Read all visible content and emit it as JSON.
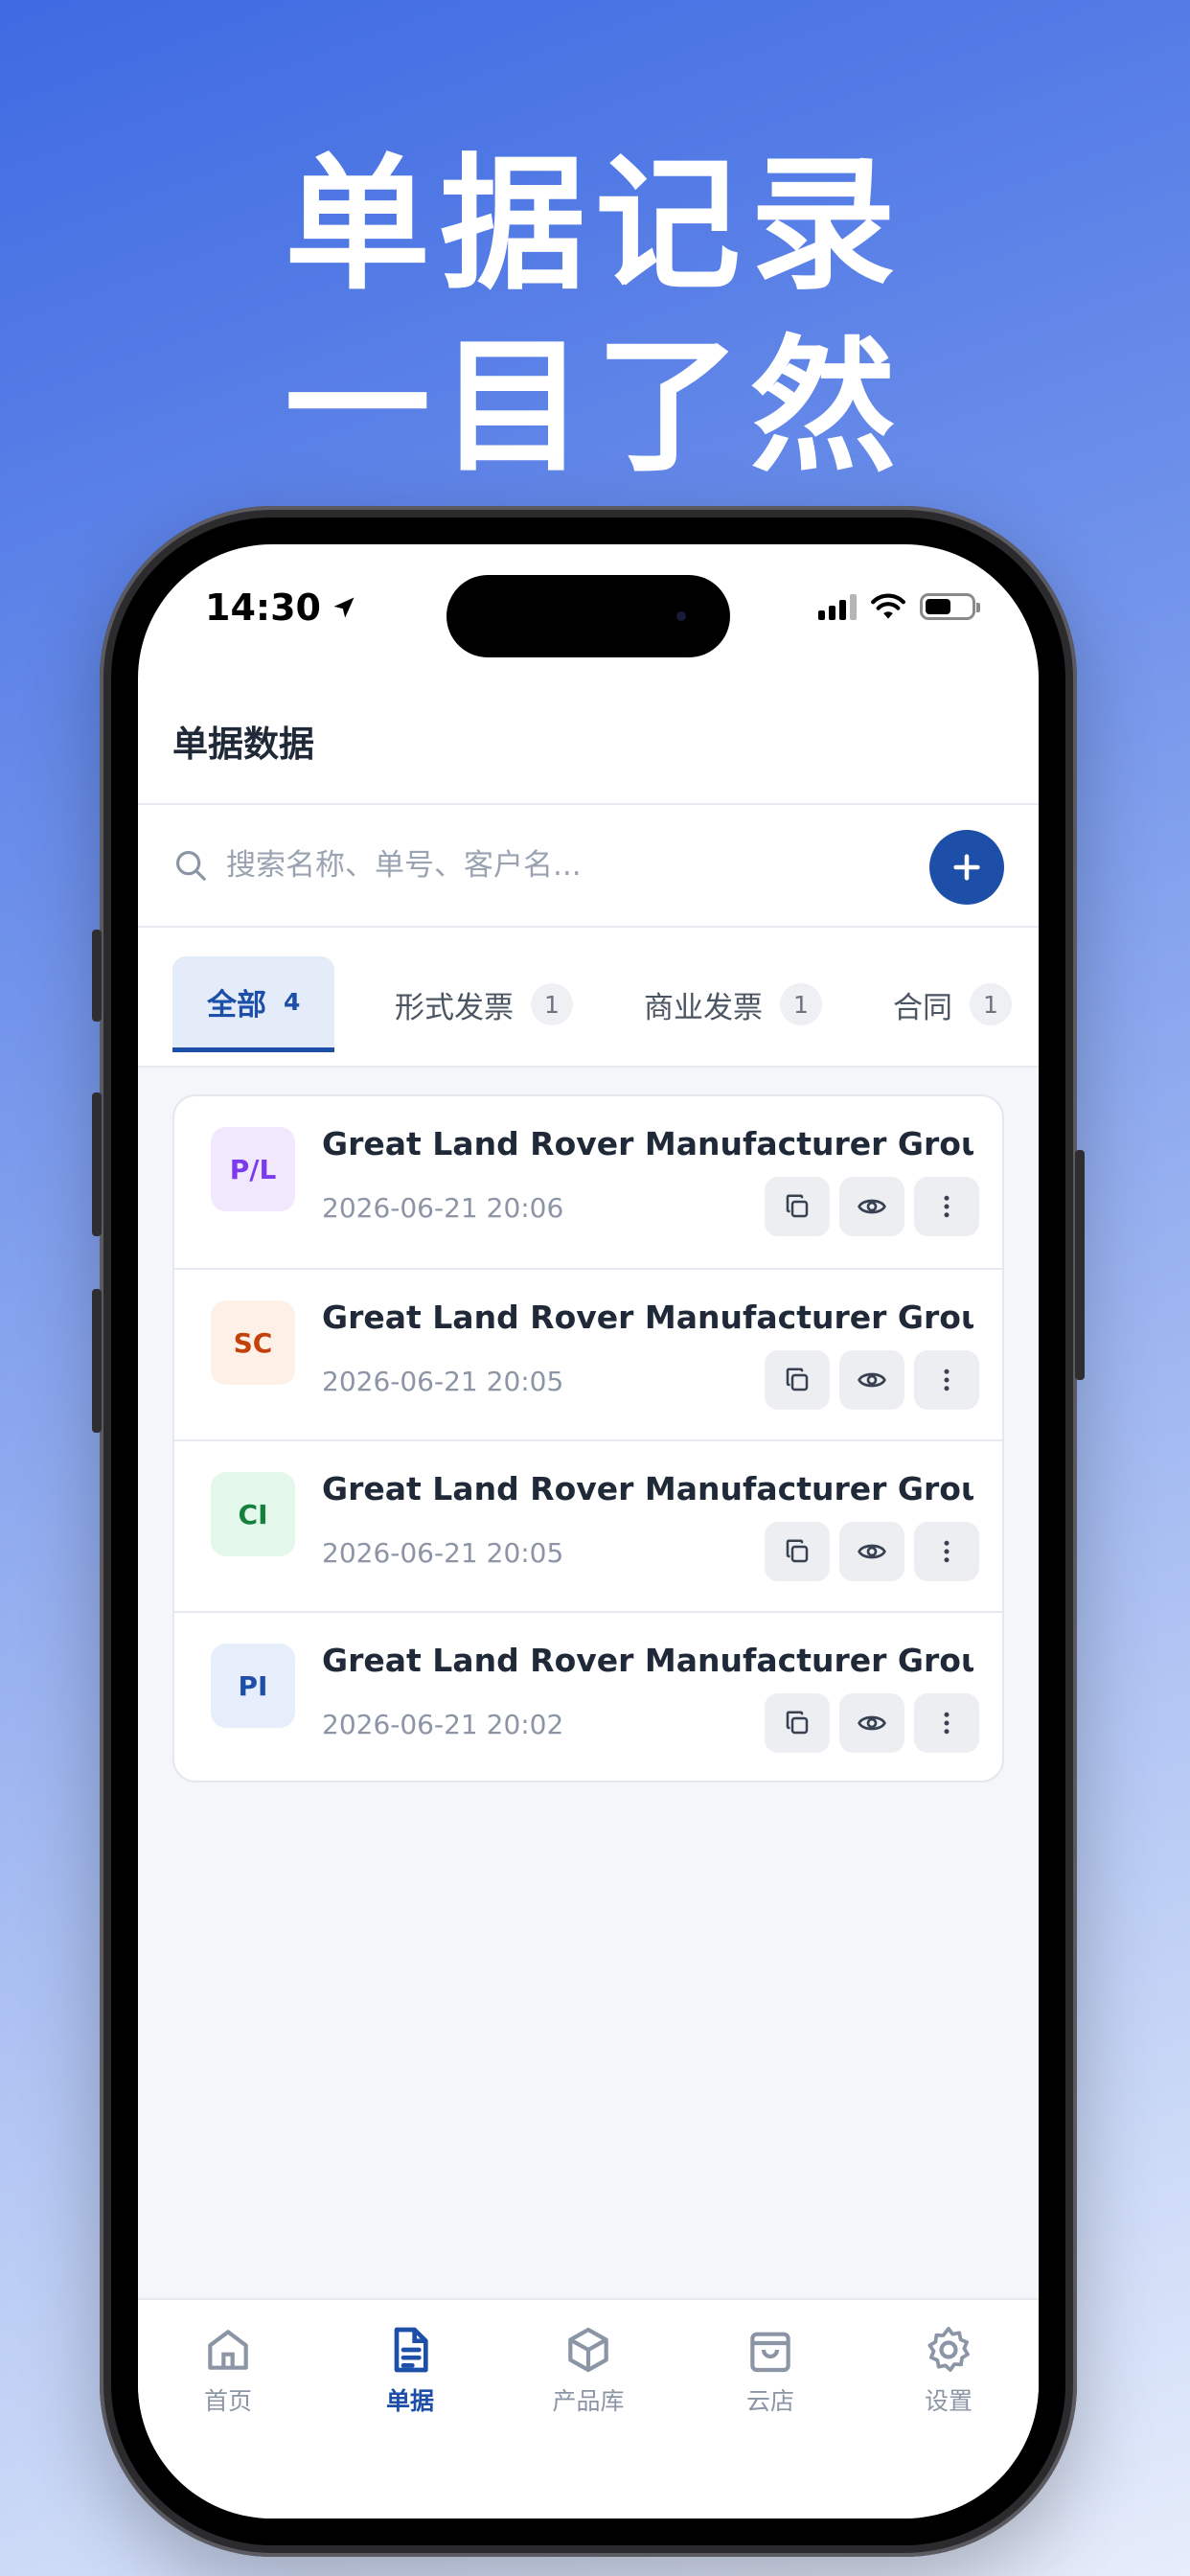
{
  "headline": {
    "line1": "单据记录",
    "line2": "一目了然"
  },
  "status_bar": {
    "time": "14:30"
  },
  "page": {
    "title": "单据数据"
  },
  "search": {
    "placeholder": "搜索名称、单号、客户名..."
  },
  "tabs": [
    {
      "label": "全部",
      "count": "4",
      "active": true
    },
    {
      "label": "形式发票",
      "count": "1"
    },
    {
      "label": "商业发票",
      "count": "1"
    },
    {
      "label": "合同",
      "count": "1"
    }
  ],
  "documents": [
    {
      "badge": "P/L",
      "badge_color": "#7c3aed",
      "badge_bg": "#f1e8fd",
      "title": "Great Land Rover Manufacturer Group ...",
      "date": "2026-06-21 20:06"
    },
    {
      "badge": "SC",
      "badge_color": "#c2410c",
      "badge_bg": "#fdf0e6",
      "title": "Great Land Rover Manufacturer Group ...",
      "date": "2026-06-21 20:05"
    },
    {
      "badge": "CI",
      "badge_color": "#15803d",
      "badge_bg": "#e3f7ea",
      "title": "Great Land Rover Manufacturer Group ...",
      "date": "2026-06-21 20:05"
    },
    {
      "badge": "PI",
      "badge_color": "#1d4fa8",
      "badge_bg": "#e6eefb",
      "title": "Great Land Rover Manufacturer Group ...",
      "date": "2026-06-21 20:02"
    }
  ],
  "row_actions": [
    "copy-icon",
    "eye-icon",
    "more-vertical-icon"
  ],
  "bottom_nav": [
    {
      "label": "首页",
      "icon": "home-icon"
    },
    {
      "label": "单据",
      "icon": "document-icon",
      "active": true
    },
    {
      "label": "产品库",
      "icon": "box-icon"
    },
    {
      "label": "云店",
      "icon": "bag-icon"
    },
    {
      "label": "设置",
      "icon": "gear-icon"
    }
  ],
  "colors": {
    "accent": "#1d4fa8",
    "background_gradient_start": "#3e6ae2",
    "background_gradient_end": "#e6edfb"
  }
}
